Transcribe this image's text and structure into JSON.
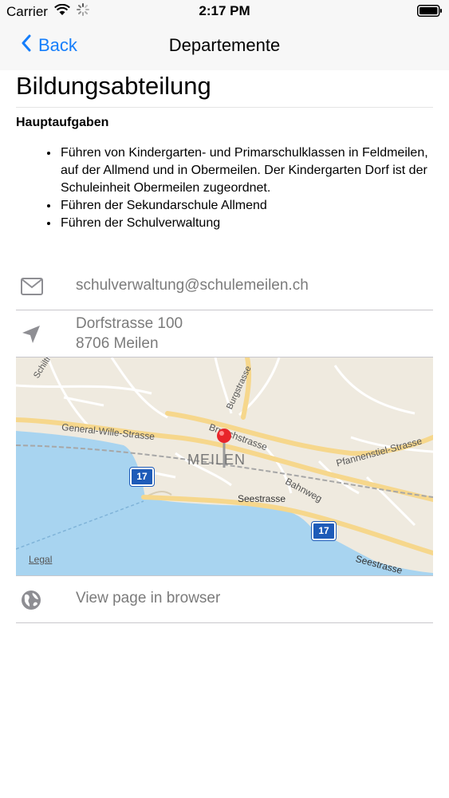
{
  "status_bar": {
    "carrier": "Carrier",
    "time": "2:17 PM"
  },
  "nav": {
    "back_label": "Back",
    "title": "Departemente"
  },
  "department": {
    "name": "Bildungsabteilung",
    "tasks_heading": "Hauptaufgaben",
    "tasks": [
      "Führen von Kindergarten- und Primarschulklassen in Feldmeilen, auf der Allmend und in Obermeilen. Der Kindergarten Dorf ist der Schuleinheit Obermeilen zugeordnet.",
      "Führen der Sekundarschule Allmend",
      "Führen der Schulverwaltung"
    ]
  },
  "contact": {
    "email": "schulverwaltung@schulemeilen.ch",
    "address_line1": "Dorfstrasse 100",
    "address_line2": "8706 Meilen",
    "browser_link": "View page in browser"
  },
  "map": {
    "town_label": "MEILEN",
    "legal": "Legal",
    "route_shield": "17",
    "streets": {
      "schiltrain": "Schiltrain",
      "general_wille": "General-Wille-Strasse",
      "burgstrasse": "Burgstrasse",
      "bruechstrasse": "Bruechstrasse",
      "pfannenstiel": "Pfannenstiel-Strasse",
      "bahnweg": "Bahnweg",
      "seestrasse": "Seestrasse"
    }
  },
  "colors": {
    "accent": "#157efb",
    "lake": "#a8d4f0",
    "land": "#efeadf",
    "pin": "#e8252a"
  }
}
